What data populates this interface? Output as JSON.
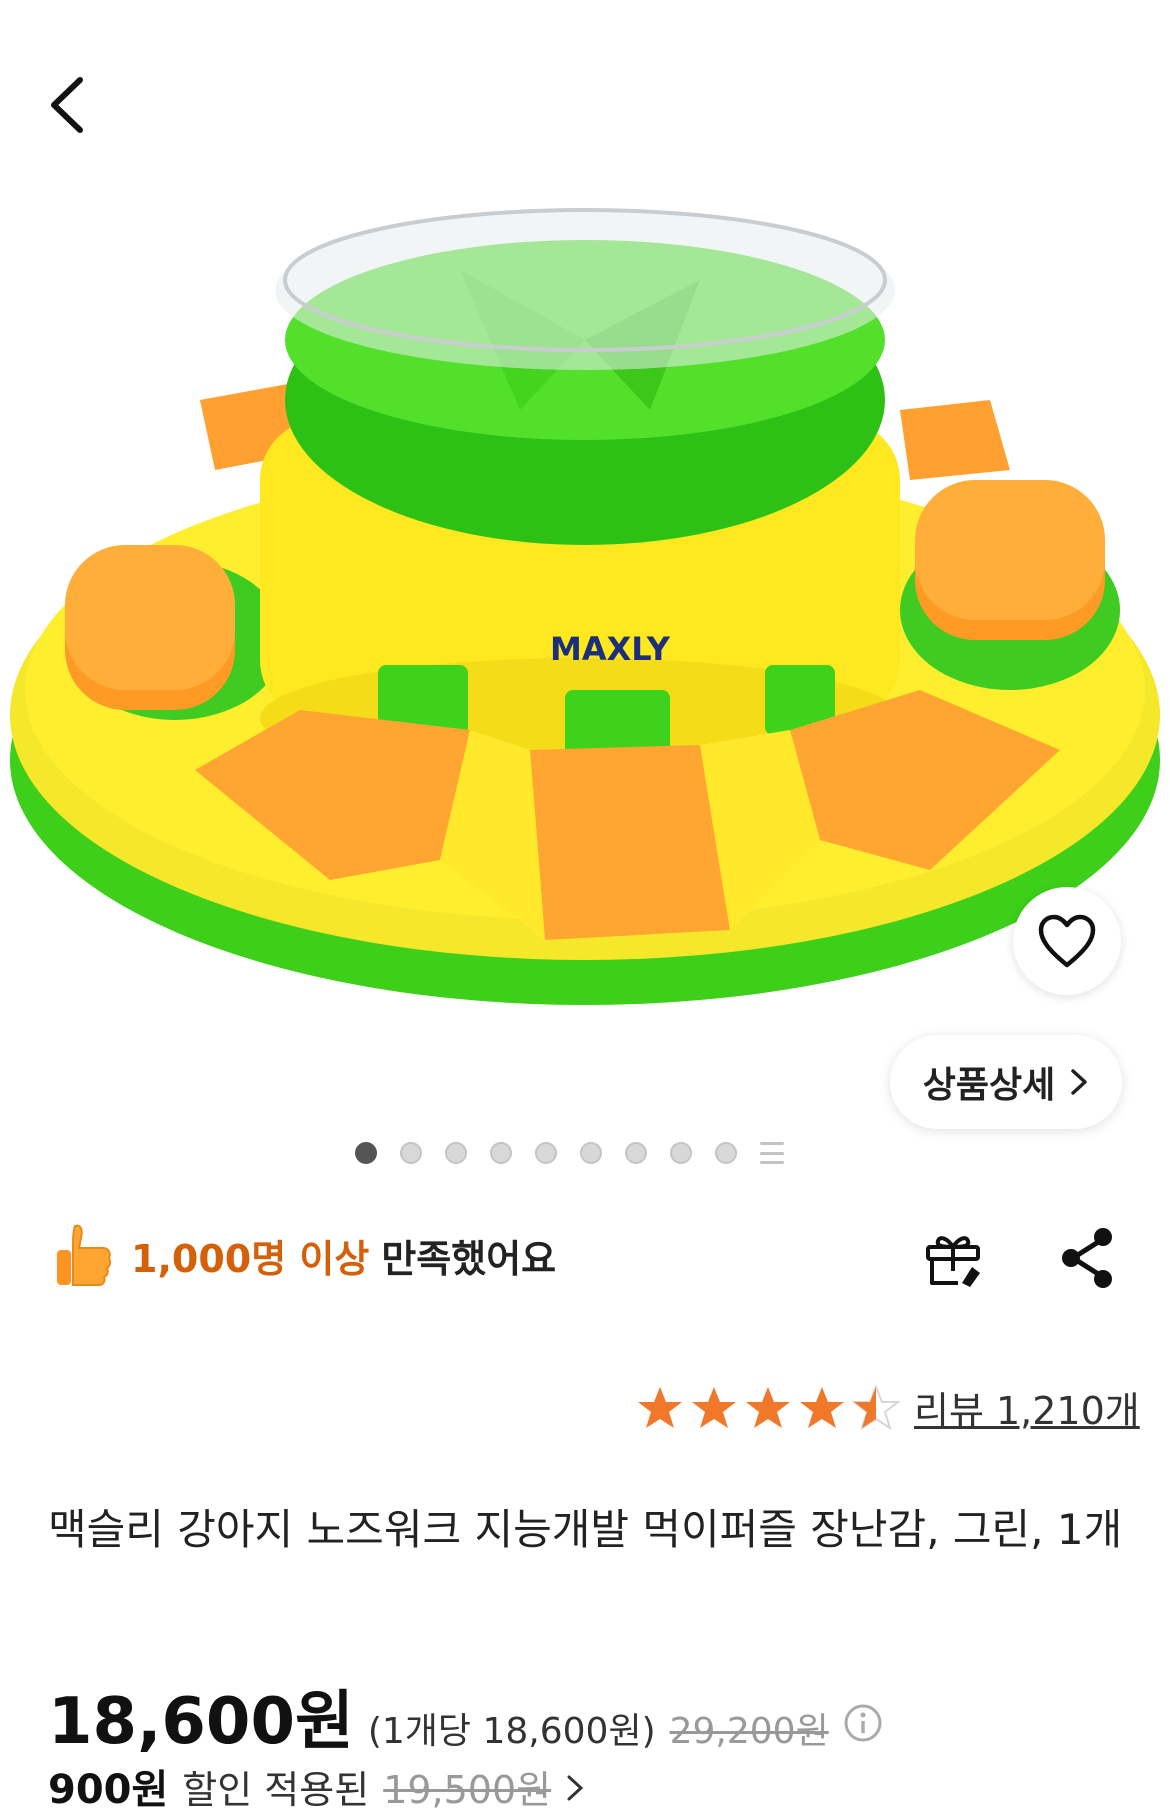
{
  "header": {
    "back_icon": "chevron-left-icon"
  },
  "product_image": {
    "brand_logo": "MAXLY",
    "slide_count": 9,
    "active_slide": 1
  },
  "buttons": {
    "wish_icon": "heart-icon",
    "detail_label": "상품상세",
    "detail_icon": "chevron-right-icon",
    "gift_icon": "gift-icon",
    "share_icon": "share-icon"
  },
  "satisfaction": {
    "icon": "thumbs-up-icon",
    "highlight": "1,000명 이상",
    "text": "만족했어요"
  },
  "rating": {
    "stars": 4.5,
    "review_label": "리뷰 1,210개"
  },
  "product": {
    "title": "맥슬리 강아지 노즈워크 지능개발 먹이퍼즐 장난감, 그린, 1개"
  },
  "price": {
    "current": "18,600원",
    "unit_price": "(1개당 18,600원)",
    "original": "29,200원",
    "info_icon": "info-icon"
  },
  "discount": {
    "amount": "900원",
    "label": "할인 적용된",
    "price": "19,500원"
  },
  "colors": {
    "accent": "#d4600a",
    "star": "#f0782a"
  }
}
